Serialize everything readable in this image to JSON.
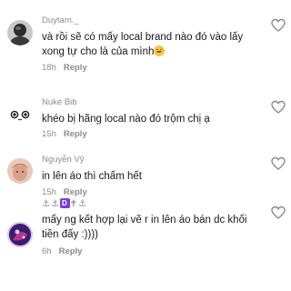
{
  "comments": [
    {
      "username": "Duytam._",
      "text": "và rồi sẽ có mấy local brand nào đó vào lấy xong tự cho là của mình",
      "emoji": "grinning-sweat-emoji",
      "time": "18h",
      "reply_label": "Reply",
      "avatar_colors": [
        "#2b2b2b",
        "#6b6b6b",
        "#c9c9c9"
      ]
    },
    {
      "username": "Nuke Bib",
      "text": "khéo bị hãng local nào đó trộm chị ạ",
      "time": "15h",
      "reply_label": "Reply",
      "avatar_colors": [
        "#ffffff",
        "#1e1e1e"
      ]
    },
    {
      "username": "Nguyễn Vỹ",
      "text": "in lên áo thì chấm hết",
      "time": "15h",
      "reply_label": "Reply",
      "avatar_colors": [
        "#d9a08a",
        "#8a3b2c",
        "#e8c9b8"
      ]
    },
    {
      "username_symbols": [
        "⚓",
        "⚓",
        "✝",
        "⚓"
      ],
      "username_badge": "D",
      "text": "mấy ng kết hợp lại vẽ r in lên áo bán dc khối tiền đấy :))))",
      "time": "6h",
      "reply_label": "Reply",
      "avatar_colors": [
        "#3a1d6e",
        "#b03a8a",
        "#e0c0e8"
      ]
    }
  ],
  "icons": {
    "like": "heart-outline-icon"
  },
  "colors": {
    "text": "#161823",
    "muted": "#8a8b91",
    "badge": "#7a3ddc"
  }
}
